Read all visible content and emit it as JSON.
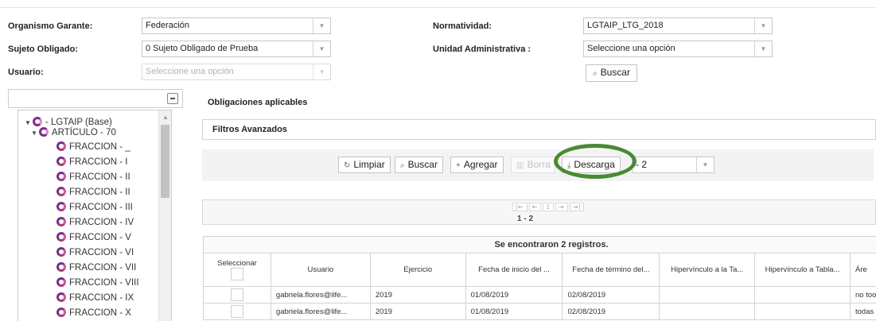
{
  "filters": {
    "organismo_label": "Organismo Garante:",
    "organismo_value": "Federación",
    "sujeto_label": "Sujeto Obligado:",
    "sujeto_value": "0 Sujeto Obligado de Prueba",
    "usuario_label": "Usuario:",
    "usuario_placeholder": "Seleccione una opción",
    "normatividad_label": "Normatividad:",
    "normatividad_value": "LGTAIP_LTG_2018",
    "unidad_label": "Unidad Administrativa :",
    "unidad_value": "Seleccione una opción",
    "buscar_label": "Buscar"
  },
  "tree": {
    "root": "- LGTAIP (Base)",
    "article": "ARTÍCULO - 70",
    "items": [
      "FRACCION - _",
      "FRACCION - I",
      "FRACCION - II",
      "FRACCION - II",
      "FRACCION - III",
      "FRACCION - IV",
      "FRACCION - V",
      "FRACCION - VI",
      "FRACCION - VII",
      "FRACCION - VIII",
      "FRACCION - IX",
      "FRACCION - X"
    ]
  },
  "main": {
    "obligaciones_title": "Obligaciones aplicables",
    "filtros_avanzados": "Filtros Avanzados"
  },
  "toolbar": {
    "limpiar": "Limpiar",
    "buscar": "Buscar",
    "agregar": "Agregar",
    "borrar": "Borra",
    "descarga": "Descarga",
    "format_value": "- 2"
  },
  "pager": {
    "current_page": "1",
    "range": "1 - 2"
  },
  "table": {
    "caption": "Se encontraron 2 registros.",
    "select_header": "Seleccionar",
    "headers": [
      "Usuario",
      "Ejercicio",
      "Fecha de inicio del ...",
      "Fecha de término del...",
      "Hipervínculo a la Ta...",
      "Hipervínculo a Tabla...",
      "Áre"
    ],
    "rows": [
      {
        "usuario": "gabriela.flores@life...",
        "ejercicio": "2019",
        "inicio": "01/08/2019",
        "termino": "02/08/2019",
        "hip1": "",
        "hip2": "",
        "area": "no too"
      },
      {
        "usuario": "gabriela.flores@life...",
        "ejercicio": "2019",
        "inicio": "01/08/2019",
        "termino": "02/08/2019",
        "hip1": "",
        "hip2": "",
        "area": "todas"
      }
    ]
  },
  "colors": {
    "highlight": "#4a8a32",
    "tree_icon": "#7b2c8f"
  }
}
